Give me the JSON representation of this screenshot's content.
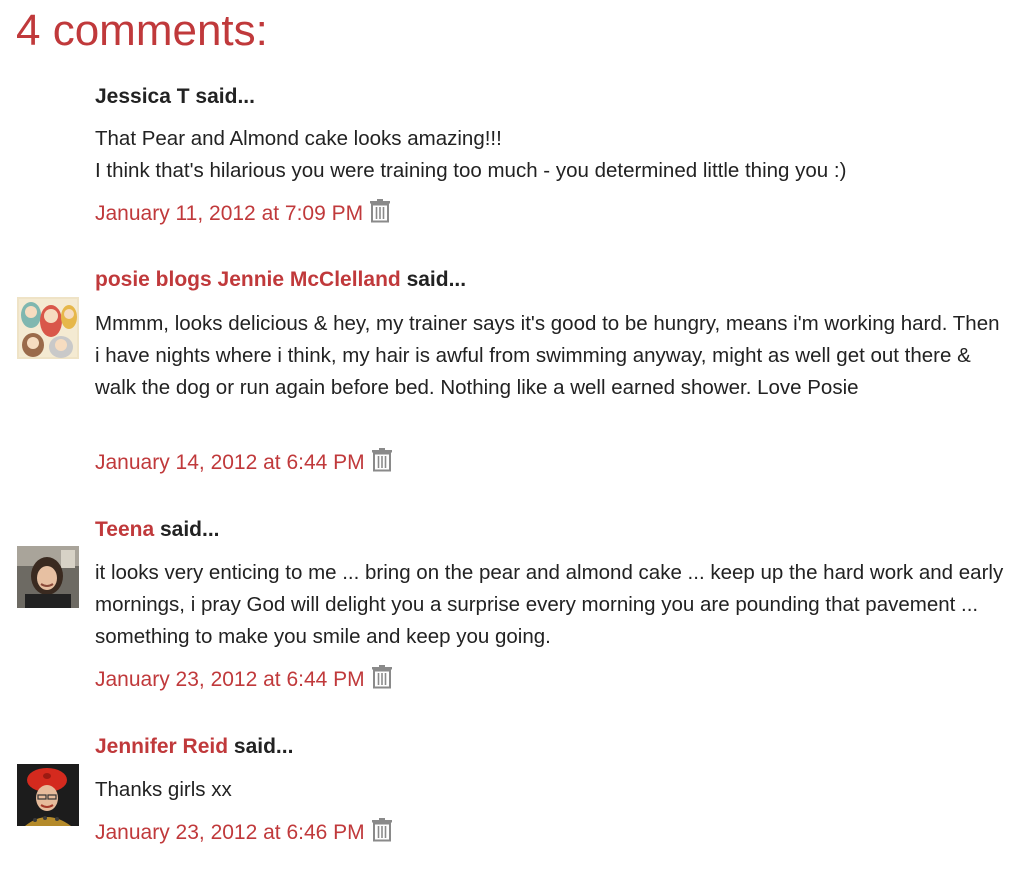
{
  "heading": "4 comments:",
  "said_suffix": "said...",
  "icons": {
    "delete": "trash-icon"
  },
  "colors": {
    "accent": "#c0393b",
    "text": "#222222",
    "icon": "#8a8a8a"
  },
  "comments": [
    {
      "author": "Jessica T",
      "author_is_link": false,
      "has_avatar": false,
      "body": [
        "That Pear and Almond cake looks amazing!!!",
        "I think that's hilarious you were training too much - you determined little thing you :)"
      ],
      "timestamp": "January 11, 2012 at 7:09 PM"
    },
    {
      "author": "posie blogs Jennie McClelland",
      "author_is_link": true,
      "has_avatar": true,
      "body": [
        "Mmmm, looks delicious & hey, my trainer says it's good to be hungry, means i'm working hard. Then i have nights where i think, my hair is awful from swimming anyway, might as well get out there & walk the dog or run again before bed. Nothing like a well earned shower. Love Posie"
      ],
      "timestamp": "January 14, 2012 at 6:44 PM"
    },
    {
      "author": "Teena",
      "author_is_link": true,
      "has_avatar": true,
      "body": [
        "it looks very enticing to me ... bring on the pear and almond cake ... keep up the hard work and early mornings, i pray God will delight you a surprise every morning you are pounding that pavement ... something to make you smile and keep you going."
      ],
      "timestamp": "January 23, 2012 at 6:44 PM"
    },
    {
      "author": "Jennifer Reid",
      "author_is_link": true,
      "has_avatar": true,
      "body": [
        "Thanks girls xx"
      ],
      "timestamp": "January 23, 2012 at 6:46 PM"
    }
  ]
}
